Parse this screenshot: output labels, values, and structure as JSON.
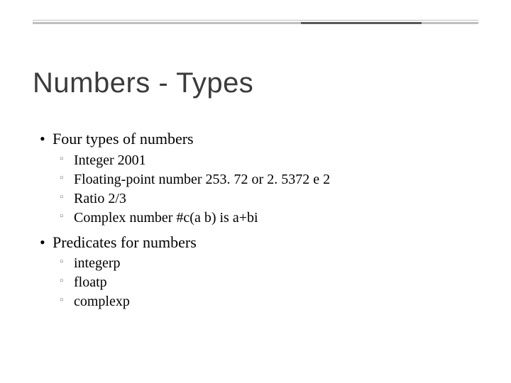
{
  "title": "Numbers - Types",
  "sections": [
    {
      "heading": "Four types of numbers",
      "items": [
        "Integer   2001",
        "Floating-point number   253. 72 or 2. 5372 e 2",
        "Ratio   2/3",
        "Complex number   #c(a b) is a+bi"
      ]
    },
    {
      "heading": "Predicates for numbers",
      "items": [
        "integerp",
        "floatp",
        "complexp"
      ]
    }
  ]
}
